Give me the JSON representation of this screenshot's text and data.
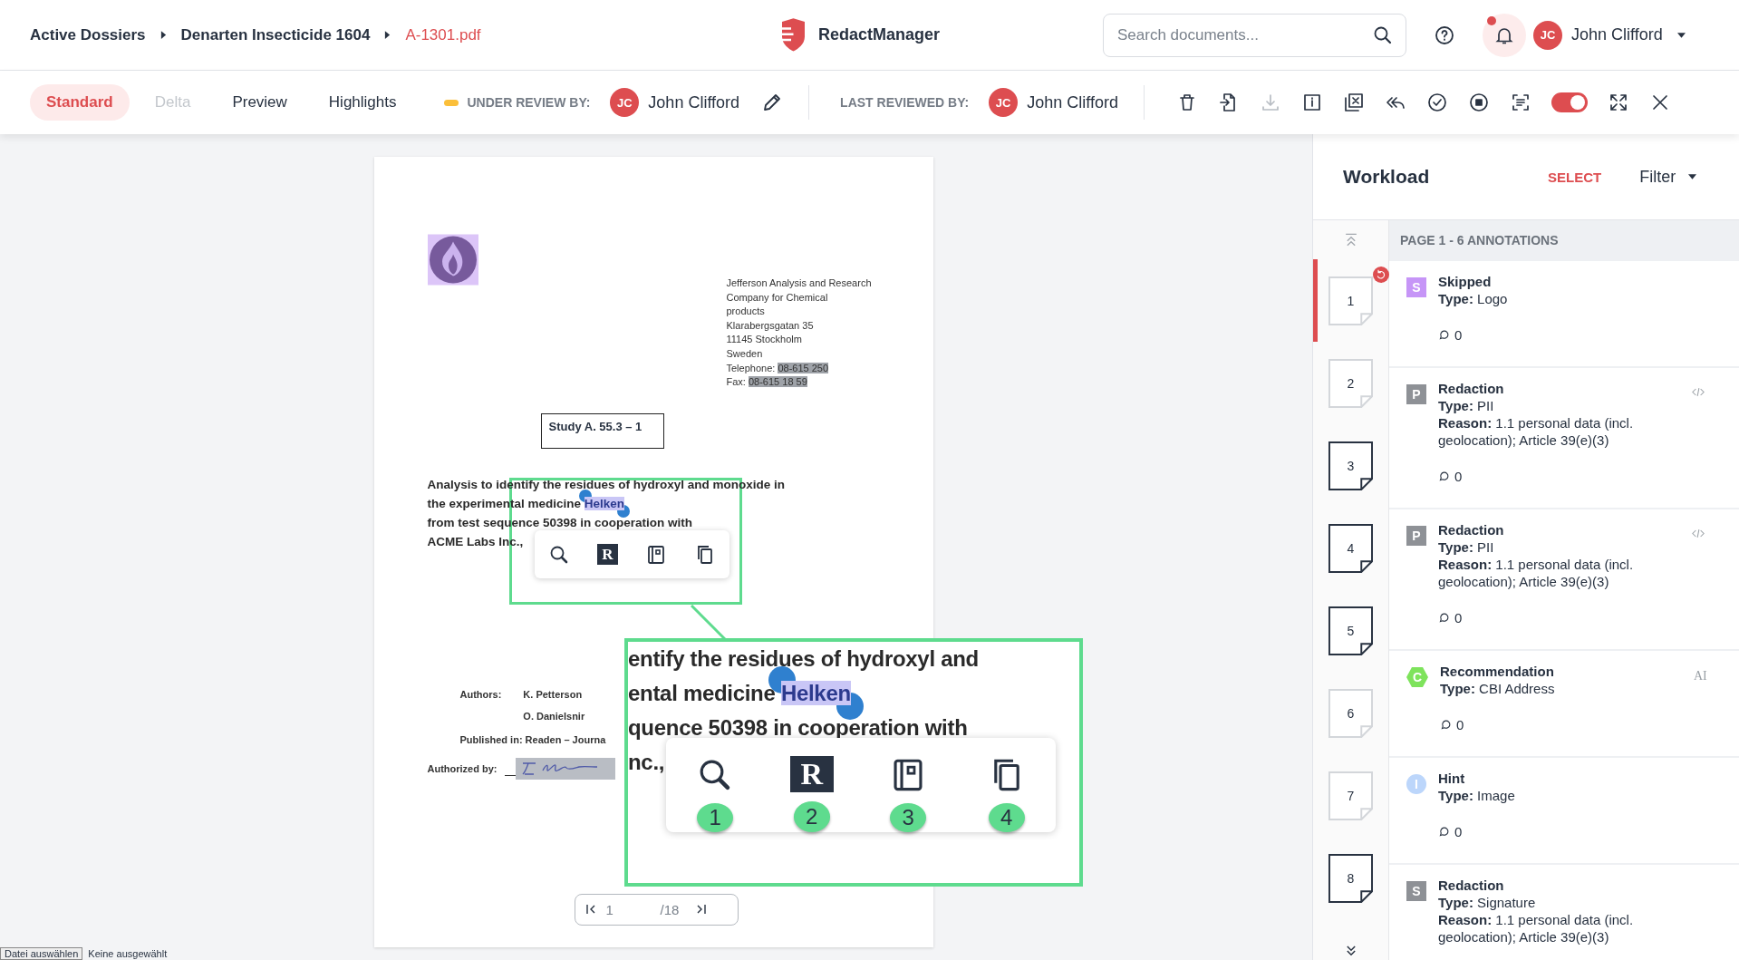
{
  "breadcrumb": [
    {
      "label": "Active Dossiers",
      "current": false
    },
    {
      "label": "Denarten Insecticide 1604",
      "current": false
    },
    {
      "label": "A-1301.pdf",
      "current": true
    }
  ],
  "app_name": "RedactManager",
  "search": {
    "placeholder": "Search documents..."
  },
  "notifications": {
    "unread": true
  },
  "user": {
    "initials": "JC",
    "name": "John Clifford"
  },
  "view_tabs": [
    {
      "label": "Standard",
      "selected": true,
      "disabled": false
    },
    {
      "label": "Delta",
      "selected": false,
      "disabled": true
    },
    {
      "label": "Preview",
      "selected": false,
      "disabled": false
    },
    {
      "label": "Highlights",
      "selected": false,
      "disabled": false
    }
  ],
  "under_review": {
    "label": "UNDER REVIEW BY:",
    "initials": "JC",
    "name": "John Clifford"
  },
  "last_reviewed": {
    "label": "LAST REVIEWED BY:",
    "initials": "JC",
    "name": "John Clifford"
  },
  "toolbar": [
    {
      "kind": "delete",
      "disabled": false
    },
    {
      "kind": "import",
      "disabled": false
    },
    {
      "kind": "download",
      "disabled": true
    },
    {
      "kind": "info",
      "disabled": false
    },
    {
      "kind": "remove",
      "disabled": false
    },
    {
      "kind": "reply_all",
      "disabled": false
    },
    {
      "kind": "approve",
      "disabled": false
    },
    {
      "kind": "stop",
      "disabled": false
    },
    {
      "kind": "scan",
      "disabled": false
    },
    {
      "kind": "toggle",
      "on": true
    },
    {
      "kind": "fullscreen",
      "disabled": false
    },
    {
      "kind": "close",
      "disabled": false
    }
  ],
  "document": {
    "address_lines": [
      "Jefferson Analysis and Research",
      "Company for Chemical",
      "products",
      "Klarabergsgatan 35",
      "11145 Stockholm",
      "Sweden"
    ],
    "contact_lines": [
      {
        "label": "Telephone:",
        "value": "08-615 250",
        "redacted": true
      },
      {
        "label": "Fax:",
        "value": "08-615 18 59",
        "redacted": true
      }
    ],
    "study": "Study A. 55.3 – 1",
    "heading_lines": [
      [
        {
          "text": "Analysis to identify the residues of hydroxyl and monoxide in",
          "highlighted": false
        }
      ],
      [
        {
          "text": "the experimental medicine ",
          "highlighted": false
        },
        {
          "text": "Helken",
          "highlighted": true
        }
      ],
      [
        {
          "text": "from test sequence 50398 in cooperation with",
          "highlighted": false
        }
      ],
      [
        {
          "text": "ACME Labs Inc.,",
          "highlighted": false
        }
      ]
    ],
    "authors_label": "Authors:",
    "authors": [
      "K. Petterson",
      "O. Danielsnir"
    ],
    "published": "Published in: Readen – Journa",
    "authorized_label": "Authorized by:",
    "page_nav": {
      "page": "1",
      "total": "/18"
    }
  },
  "popup_tools": [
    {
      "kind": "search"
    },
    {
      "kind": "redact",
      "letter": "R"
    },
    {
      "kind": "dictionary"
    },
    {
      "kind": "copy"
    }
  ],
  "zoom_inset": {
    "lines": [
      [
        {
          "text": "entify the residues of hydroxyl and",
          "highlighted": false
        }
      ],
      [
        {
          "text": "ental medicine ",
          "highlighted": false
        },
        {
          "text": "Helken",
          "highlighted": true
        }
      ],
      [
        {
          "text": "quence 50398 in cooperation with",
          "highlighted": false
        }
      ],
      [
        {
          "text": "nc.,",
          "highlighted": false
        }
      ]
    ],
    "tools": [
      {
        "kind": "search",
        "badge": "1"
      },
      {
        "kind": "redact",
        "letter": "R",
        "badge": "2"
      },
      {
        "kind": "dictionary",
        "badge": "3"
      },
      {
        "kind": "copy",
        "badge": "4"
      }
    ]
  },
  "file_picker": {
    "button": "Datei auswählen",
    "status": "Keine ausgewählt"
  },
  "workload": {
    "title": "Workload",
    "select": "SELECT",
    "filter": "Filter",
    "page_header": "PAGE 1 - 6 ANNOTATIONS",
    "pages": [
      {
        "number": "1",
        "selected": true,
        "dark_outline": false,
        "reset_badge": true
      },
      {
        "number": "2",
        "selected": false,
        "dark_outline": false,
        "reset_badge": false
      },
      {
        "number": "3",
        "selected": false,
        "dark_outline": true,
        "reset_badge": false
      },
      {
        "number": "4",
        "selected": false,
        "dark_outline": true,
        "reset_badge": false
      },
      {
        "number": "5",
        "selected": false,
        "dark_outline": true,
        "reset_badge": false
      },
      {
        "number": "6",
        "selected": false,
        "dark_outline": false,
        "reset_badge": false
      },
      {
        "number": "7",
        "selected": false,
        "dark_outline": false,
        "reset_badge": false
      },
      {
        "number": "8",
        "selected": false,
        "dark_outline": true,
        "reset_badge": false
      }
    ],
    "annotations": [
      {
        "badge": "S",
        "kind": "square",
        "color": "#c695f7",
        "title": "Skipped",
        "type": "**Type:** Logo",
        "comments": "0",
        "code_icon": false
      },
      {
        "badge": "P",
        "kind": "square",
        "color": "#8e9196",
        "title": "Redaction",
        "type": "**Type:** PII",
        "reason": "**Reason:** 1.1 personal data (incl. geolocation); Article 39(e)(3)",
        "comments": "0",
        "code_icon": true
      },
      {
        "badge": "P",
        "kind": "square",
        "color": "#8e9196",
        "title": "Redaction",
        "type": "**Type:** PII",
        "reason": "**Reason:** 1.1 personal data (incl. geolocation); Article 39(e)(3)",
        "comments": "0",
        "code_icon": true
      },
      {
        "badge": "C",
        "kind": "hexagon",
        "color": "#7ee35c",
        "title": "Recommendation",
        "type": "**Type:** CBI Address",
        "comments": "0",
        "code_icon": false,
        "tag": "AI"
      },
      {
        "badge": "I",
        "kind": "circle",
        "color": "#bcd6fb",
        "title": "Hint",
        "type": "**Type:** Image",
        "comments": "0",
        "code_icon": false
      },
      {
        "badge": "S",
        "kind": "square",
        "color": "#8e9196",
        "title": "Redaction",
        "type": "**Type:** Signature",
        "reason": "**Reason:** 1.1 personal data (incl. geolocation); Article 39(e)(3)",
        "code_icon": false
      }
    ]
  }
}
